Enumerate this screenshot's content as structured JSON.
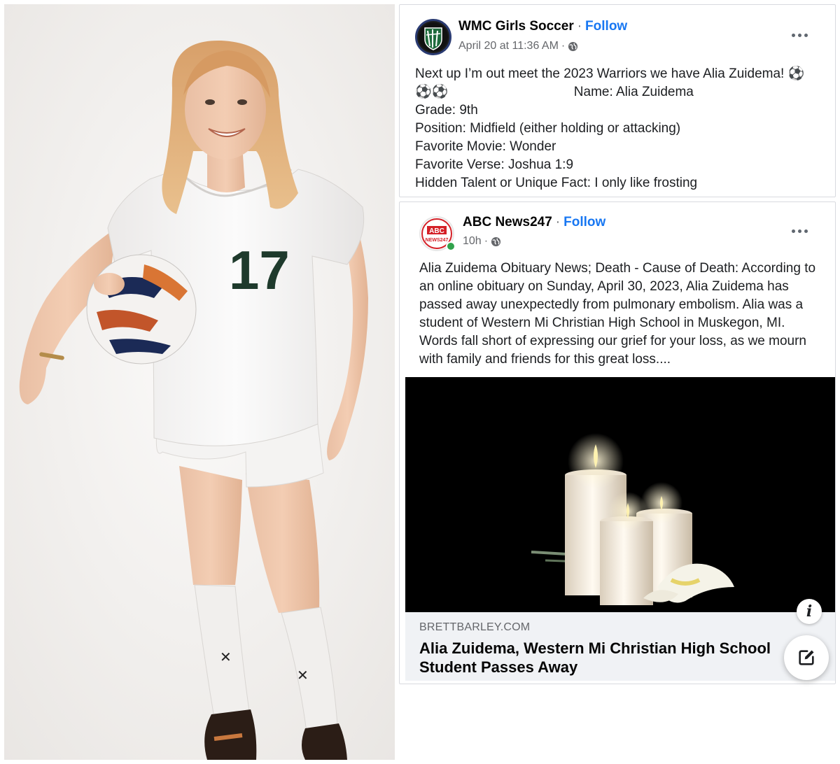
{
  "photo": {
    "jersey_number": "17",
    "icon": "soccer-player-photo"
  },
  "post1": {
    "page_name": "WMC Girls Soccer",
    "separator": "·",
    "follow_label": "Follow",
    "timestamp": "April 20 at 11:36 AM",
    "audience_separator": "·",
    "lines": [
      "Next up I’m out meet the 2023 Warriors we have Alia Zuidema! ⚽",
      "⚽⚽                                  Name: Alia Zuidema",
      "Grade: 9th",
      "Position: Midfield (either holding or attacking)",
      "Favorite Movie: Wonder",
      "Favorite Verse: Joshua 1:9",
      "Hidden Talent or Unique Fact: I only like frosting"
    ],
    "more_icon": "more-options-icon",
    "audience_icon": "globe-icon"
  },
  "post2": {
    "page_name": "ABC News247",
    "separator": "·",
    "follow_label": "Follow",
    "timestamp": "10h",
    "audience_separator": "·",
    "avatar_text_top": "ABC",
    "avatar_text_bottom": "NEWS247",
    "lines": [
      "Alia Zuidema Obituary News; Death - Cause of Death: According to",
      "an online obituary on Sunday, April 30, 2023, Alia Zuidema has",
      "passed away unexpectedly from pulmonary embolism. Alia was a",
      "student of Western Mi Christian High School in Muskegon, MI.",
      "Words fall short of expressing our grief for your loss, as we mourn",
      "with family and friends for this great loss...."
    ],
    "link_domain": "BRETTBARLEY.COM",
    "link_title": "Alia Zuidema, Western Mi Christian High School Student Passes Away",
    "info_label": "i",
    "more_icon": "more-options-icon",
    "audience_icon": "globe-icon",
    "image_icon": "candles-image"
  },
  "compose_icon": "compose-icon",
  "colors": {
    "follow": "#1877f2",
    "meta": "#65676b",
    "link_footer_bg": "#f0f2f5",
    "online_dot": "#31a24c",
    "abc_red": "#d42027"
  }
}
